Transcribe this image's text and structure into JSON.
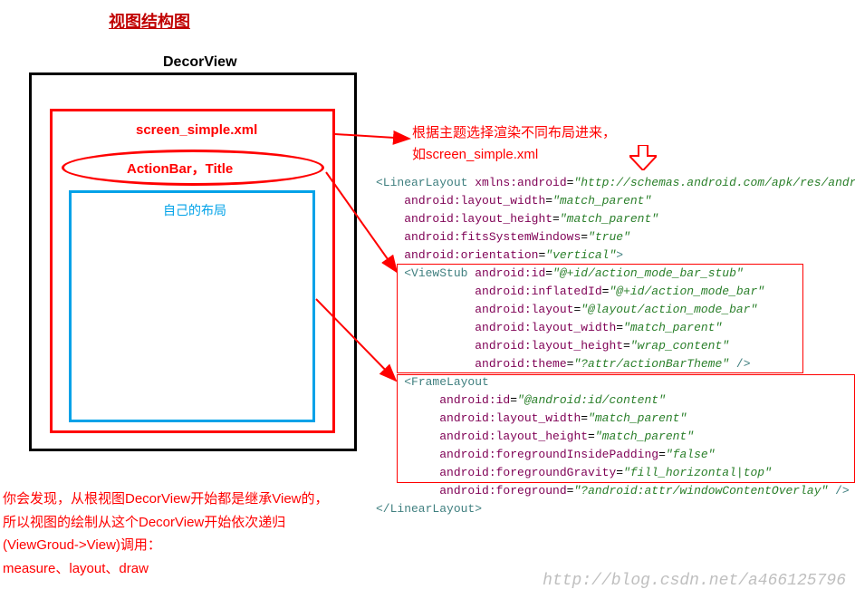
{
  "title": "视图结构图",
  "decorview_label": "DecorView",
  "screen_simple_label": "screen_simple.xml",
  "actionbar_label": "ActionBar，Title",
  "self_layout_label": "自己的布局",
  "right_note_line1": "根据主题选择渲染不同布局进来，",
  "right_note_line2": "如screen_simple.xml",
  "xml": {
    "ll_open": "<LinearLayout ",
    "xmlns_attr": "xmlns:android",
    "xmlns_val": "\"http://schemas.android.com/apk/res/android\"",
    "lw_attr": "android:layout_width",
    "lw_val": "\"match_parent\"",
    "lh_attr": "android:layout_height",
    "lh_val": "\"match_parent\"",
    "fsw_attr": "android:fitsSystemWindows",
    "fsw_val": "\"true\"",
    "ori_attr": "android:orientation",
    "ori_val": "\"vertical\"",
    "close_angle": ">",
    "vs_open": "<ViewStub ",
    "vs_id_attr": "android:id",
    "vs_id_val": "\"@+id/action_mode_bar_stub\"",
    "vs_inf_attr": "android:inflatedId",
    "vs_inf_val": "\"@+id/action_mode_bar\"",
    "vs_lay_attr": "android:layout",
    "vs_lay_val": "\"@layout/action_mode_bar\"",
    "vs_lw_attr": "android:layout_width",
    "vs_lw_val": "\"match_parent\"",
    "vs_lh_attr": "android:layout_height",
    "vs_lh_val": "\"wrap_content\"",
    "vs_theme_attr": "android:theme",
    "vs_theme_val": "\"?attr/actionBarTheme\"",
    "self_close": " />",
    "fl_open": "<FrameLayout",
    "fl_id_attr": "android:id",
    "fl_id_val": "\"@android:id/content\"",
    "fl_lw_attr": "android:layout_width",
    "fl_lw_val": "\"match_parent\"",
    "fl_lh_attr": "android:layout_height",
    "fl_lh_val": "\"match_parent\"",
    "fl_fip_attr": "android:foregroundInsidePadding",
    "fl_fip_val": "\"false\"",
    "fl_fg_attr": "android:foregroundGravity",
    "fl_fg_val": "\"fill_horizontal|top\"",
    "fl_f_attr": "android:foreground",
    "fl_f_val": "\"?android:attr/windowContentOverlay\"",
    "ll_close": "</LinearLayout>"
  },
  "bottom_note_l1": "你会发现，从根视图DecorView开始都是继承View的，",
  "bottom_note_l2": "所以视图的绘制从这个DecorView开始依次递归",
  "bottom_note_l3": "(ViewGroud->View)调用：",
  "bottom_note_l4": "measure、layout、draw",
  "watermark": "http://blog.csdn.net/a466125796"
}
